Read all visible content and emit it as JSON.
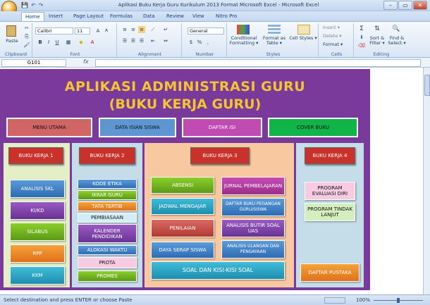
{
  "window": {
    "title": "Aplikasi Buku Kerja Guru Kurikulum 2013 Format Microsoft Excel - Microsoft Excel",
    "min": "–",
    "max": "▭",
    "close": "✕"
  },
  "qat": {
    "save": "💾",
    "undo": "↶",
    "redo": "↷"
  },
  "tabs": [
    "Home",
    "Insert",
    "Page Layout",
    "Formulas",
    "Data",
    "Review",
    "View",
    "Nitro Pro"
  ],
  "ribbon": {
    "clipboard": {
      "label": "Clipboard",
      "paste": "Paste"
    },
    "font": {
      "label": "Font",
      "name": "Calibri",
      "size": "11"
    },
    "alignment": {
      "label": "Alignment"
    },
    "number": {
      "label": "Number",
      "format": "General"
    },
    "styles": {
      "label": "Styles",
      "conditional": "Conditional Formatting ▾",
      "table": "Format as Table ▾",
      "cell": "Cell Styles ▾"
    },
    "cells": {
      "label": "Cells",
      "insert": "Insert ▾",
      "delete": "Delete ▾",
      "format": "Format ▾"
    },
    "editing": {
      "label": "Editing",
      "sort": "Sort & Filter ▾",
      "find": "Find & Select ▾"
    }
  },
  "formula_bar": {
    "namebox": "G101",
    "fx": "fx"
  },
  "app": {
    "title1": "APLIKASI ADMINISTRASI GURU",
    "title2": "(BUKU KERJA GURU)",
    "nav": {
      "menu": "MENU UTAMA",
      "data": "DATA ISIAN SISWA",
      "daftar": "DAFTAR ISI",
      "cover": "COVER BUKU"
    },
    "bk1": {
      "header": "BUKU KERJA 1",
      "items": [
        "ANALISIS SKL",
        "KI/KD",
        "SILABUS",
        "RPP",
        "KKM"
      ]
    },
    "bk2": {
      "header": "BUKU KERJA 2",
      "items": [
        "KODE ETIKA",
        "IKRAR GURU",
        "TATA TERTIB",
        "PEMBIASAAN",
        "KALENDER PENDIDIKAN",
        "ALOKASI WAKTU",
        "PROTA",
        "PROMES"
      ]
    },
    "bk3": {
      "header": "BUKU KERJA 3",
      "left": [
        "ABSENSI",
        "JADWAL MENGAJAR",
        "PENILAIAN",
        "DAYA SERAP SISWA"
      ],
      "right": [
        "JURNAL PEMBELAJARAN",
        "DAFTAR BUKU PEGANGAN GURU/SISWA",
        "ANALISIS BUTIR SOAL UAS",
        "ANALISIS ULANGAN DAN PENGAYAAN"
      ],
      "soal": "SOAL DAN KISI-KISI SOAL"
    },
    "bk4": {
      "header": "BUKU KERJA 4",
      "items": [
        "PROGRAM EVALUASI DIRI",
        "PROGRAM TINDAK LANJUT"
      ],
      "pustaka": "DAFTAR PUSTAKA"
    }
  },
  "status": {
    "text": "Select destination and press ENTER or choose Paste",
    "zoom": "100%"
  }
}
